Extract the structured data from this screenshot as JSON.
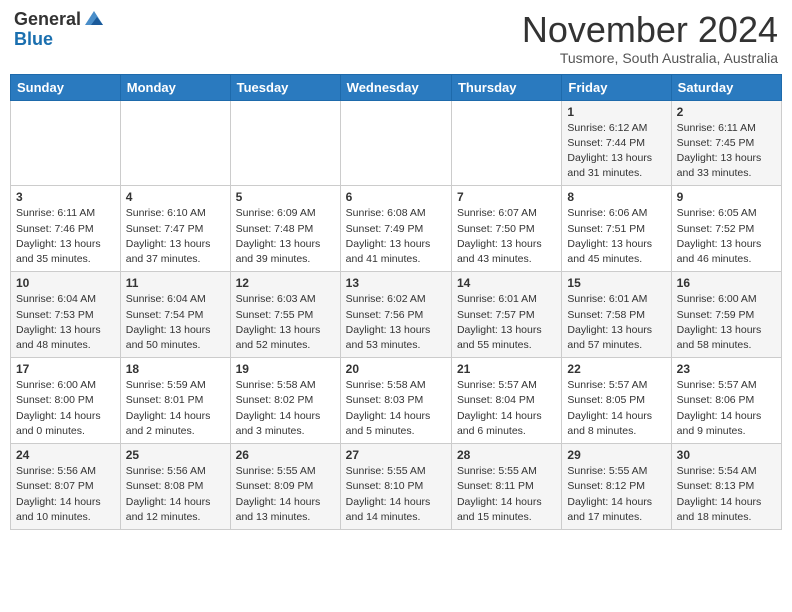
{
  "header": {
    "logo_general": "General",
    "logo_blue": "Blue",
    "month_title": "November 2024",
    "subtitle": "Tusmore, South Australia, Australia"
  },
  "days_of_week": [
    "Sunday",
    "Monday",
    "Tuesday",
    "Wednesday",
    "Thursday",
    "Friday",
    "Saturday"
  ],
  "weeks": [
    [
      {
        "day": "",
        "info": ""
      },
      {
        "day": "",
        "info": ""
      },
      {
        "day": "",
        "info": ""
      },
      {
        "day": "",
        "info": ""
      },
      {
        "day": "",
        "info": ""
      },
      {
        "day": "1",
        "info": "Sunrise: 6:12 AM\nSunset: 7:44 PM\nDaylight: 13 hours\nand 31 minutes."
      },
      {
        "day": "2",
        "info": "Sunrise: 6:11 AM\nSunset: 7:45 PM\nDaylight: 13 hours\nand 33 minutes."
      }
    ],
    [
      {
        "day": "3",
        "info": "Sunrise: 6:11 AM\nSunset: 7:46 PM\nDaylight: 13 hours\nand 35 minutes."
      },
      {
        "day": "4",
        "info": "Sunrise: 6:10 AM\nSunset: 7:47 PM\nDaylight: 13 hours\nand 37 minutes."
      },
      {
        "day": "5",
        "info": "Sunrise: 6:09 AM\nSunset: 7:48 PM\nDaylight: 13 hours\nand 39 minutes."
      },
      {
        "day": "6",
        "info": "Sunrise: 6:08 AM\nSunset: 7:49 PM\nDaylight: 13 hours\nand 41 minutes."
      },
      {
        "day": "7",
        "info": "Sunrise: 6:07 AM\nSunset: 7:50 PM\nDaylight: 13 hours\nand 43 minutes."
      },
      {
        "day": "8",
        "info": "Sunrise: 6:06 AM\nSunset: 7:51 PM\nDaylight: 13 hours\nand 45 minutes."
      },
      {
        "day": "9",
        "info": "Sunrise: 6:05 AM\nSunset: 7:52 PM\nDaylight: 13 hours\nand 46 minutes."
      }
    ],
    [
      {
        "day": "10",
        "info": "Sunrise: 6:04 AM\nSunset: 7:53 PM\nDaylight: 13 hours\nand 48 minutes."
      },
      {
        "day": "11",
        "info": "Sunrise: 6:04 AM\nSunset: 7:54 PM\nDaylight: 13 hours\nand 50 minutes."
      },
      {
        "day": "12",
        "info": "Sunrise: 6:03 AM\nSunset: 7:55 PM\nDaylight: 13 hours\nand 52 minutes."
      },
      {
        "day": "13",
        "info": "Sunrise: 6:02 AM\nSunset: 7:56 PM\nDaylight: 13 hours\nand 53 minutes."
      },
      {
        "day": "14",
        "info": "Sunrise: 6:01 AM\nSunset: 7:57 PM\nDaylight: 13 hours\nand 55 minutes."
      },
      {
        "day": "15",
        "info": "Sunrise: 6:01 AM\nSunset: 7:58 PM\nDaylight: 13 hours\nand 57 minutes."
      },
      {
        "day": "16",
        "info": "Sunrise: 6:00 AM\nSunset: 7:59 PM\nDaylight: 13 hours\nand 58 minutes."
      }
    ],
    [
      {
        "day": "17",
        "info": "Sunrise: 6:00 AM\nSunset: 8:00 PM\nDaylight: 14 hours\nand 0 minutes."
      },
      {
        "day": "18",
        "info": "Sunrise: 5:59 AM\nSunset: 8:01 PM\nDaylight: 14 hours\nand 2 minutes."
      },
      {
        "day": "19",
        "info": "Sunrise: 5:58 AM\nSunset: 8:02 PM\nDaylight: 14 hours\nand 3 minutes."
      },
      {
        "day": "20",
        "info": "Sunrise: 5:58 AM\nSunset: 8:03 PM\nDaylight: 14 hours\nand 5 minutes."
      },
      {
        "day": "21",
        "info": "Sunrise: 5:57 AM\nSunset: 8:04 PM\nDaylight: 14 hours\nand 6 minutes."
      },
      {
        "day": "22",
        "info": "Sunrise: 5:57 AM\nSunset: 8:05 PM\nDaylight: 14 hours\nand 8 minutes."
      },
      {
        "day": "23",
        "info": "Sunrise: 5:57 AM\nSunset: 8:06 PM\nDaylight: 14 hours\nand 9 minutes."
      }
    ],
    [
      {
        "day": "24",
        "info": "Sunrise: 5:56 AM\nSunset: 8:07 PM\nDaylight: 14 hours\nand 10 minutes."
      },
      {
        "day": "25",
        "info": "Sunrise: 5:56 AM\nSunset: 8:08 PM\nDaylight: 14 hours\nand 12 minutes."
      },
      {
        "day": "26",
        "info": "Sunrise: 5:55 AM\nSunset: 8:09 PM\nDaylight: 14 hours\nand 13 minutes."
      },
      {
        "day": "27",
        "info": "Sunrise: 5:55 AM\nSunset: 8:10 PM\nDaylight: 14 hours\nand 14 minutes."
      },
      {
        "day": "28",
        "info": "Sunrise: 5:55 AM\nSunset: 8:11 PM\nDaylight: 14 hours\nand 15 minutes."
      },
      {
        "day": "29",
        "info": "Sunrise: 5:55 AM\nSunset: 8:12 PM\nDaylight: 14 hours\nand 17 minutes."
      },
      {
        "day": "30",
        "info": "Sunrise: 5:54 AM\nSunset: 8:13 PM\nDaylight: 14 hours\nand 18 minutes."
      }
    ]
  ]
}
